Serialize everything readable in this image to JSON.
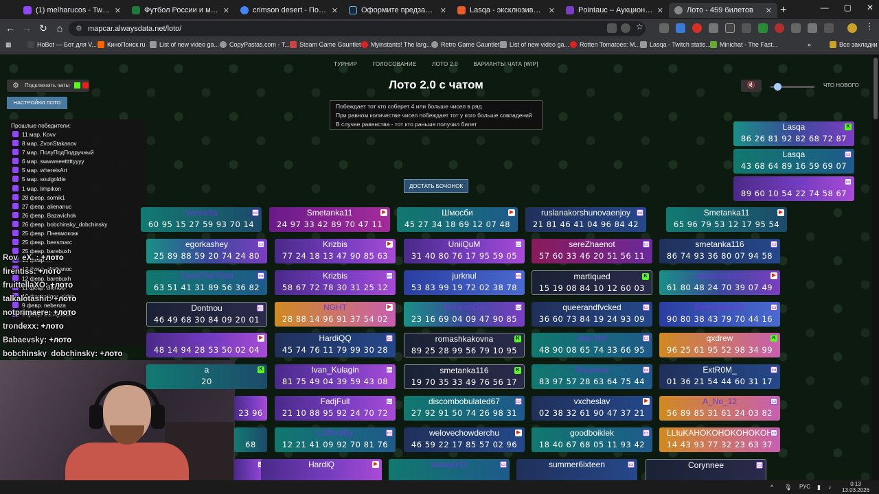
{
  "browser": {
    "tabs": [
      {
        "title": "(1) melharucos - Twitch",
        "color": "#9146ff"
      },
      {
        "title": "Футбол России и мира 2026 -",
        "color": "#1e7a3a"
      },
      {
        "title": "crimson desert - Поиск в Googl",
        "color": "#4285f4"
      },
      {
        "title": "Оформите предзаказ на Crim",
        "color": "#1b2838"
      },
      {
        "title": "Lasqa - эксклюзивный контен",
        "color": "#e85d2a"
      },
      {
        "title": "Pointauc – Аукционы, лотере",
        "color": "#7a3ec2"
      },
      {
        "title": "Лото - 459 билетов",
        "color": "#888888"
      }
    ],
    "new_tab": "+",
    "url": "mapcar.alwaysdata.net/loto/",
    "bookmarks": [
      "НоBot — Бот для V...",
      "КиноПоиск.ru",
      "List of new video ga...",
      "CopyPastas.com - T...",
      "Steam Game Gauntlet",
      "Myinstants! The larg...",
      "Retro Game Gauntlet",
      "List of new video ga...",
      "Rotten Tomatoes: M...",
      "Lasqa - Twitch statis...",
      "Minichat - The Fast..."
    ],
    "bookmarks_all": "Все закладки"
  },
  "page": {
    "nav": [
      "ТУРНИР",
      "ГОЛОСОВАНИЕ",
      "ЛОТО 2.0",
      "ВАРИАНТЫ ЧАТА [WIP]"
    ],
    "title": "Лото 2.0 с чатом",
    "rules": [
      "Побеждает тот кто соберет 4 или больше чисел в ряд",
      "При равном количестве чисел побеждает тот у кого больше совпадений",
      "В случае равенства - тот кто раньше получил билет"
    ],
    "draw_button": "ДОСТАТЬ БОЧОНОК",
    "connect_chats": "Подключить чаты",
    "settings_button": "НАСТРОЙКИ ЛОТО",
    "whats_new": "ЧТО НОВОГО",
    "volume_icon": "speaker-muted-icon",
    "slider_level": 0.1
  },
  "winners": {
    "title": "Прошлые победители:",
    "items": [
      "11 мар. Kovv",
      "8 мар. ZvonStakanov",
      "7 мар. ПолуПодПодручный",
      "6 мар. swwweeetttttyyyy",
      "5 мар. whereisArt",
      "5 мар. soulgoldie",
      "1 мар. limpikon",
      "28 февр. somik1",
      "27 февр. alienanuc",
      "26 февр. Bazavichok",
      "26 февр. bobchinsky_dobchinsky",
      "25 февр. Пневмококк",
      "25 февр. beesmarc",
      "25 февр. barebuxh",
      "15 февр. ...",
      "13 февр. chirbanoc",
      "12 февр. barebuxh",
      "11 февр. Blender",
      "10 февр. tigor_sirkin",
      "9 февр. nebenza",
      "9 февр. DE Aysobil"
    ]
  },
  "chat": [
    {
      "user": "Rov_eX_",
      "text": ": +лото"
    },
    {
      "user": "firentiss",
      "text": ": +лото"
    },
    {
      "user": "fruittellaXO",
      "text": ": +лото"
    },
    {
      "user": "talkalotashit",
      "text": ": +лото"
    },
    {
      "user": "notprimaere",
      "text": ": +лото"
    },
    {
      "user": "trondexx",
      "text": ": +лото"
    },
    {
      "user": "Babaevsky",
      "text": ": +лото"
    },
    {
      "user": "bobchinsky_dobchinsky",
      "text": ": +лото"
    }
  ],
  "tickets": [
    {
      "name": "Lasqa",
      "nums": "86 26 81 92 82 68 72 87",
      "style": "c-tealpurple",
      "badge": "kick",
      "strike": false
    },
    {
      "name": "Lasqa",
      "nums": "43 68 64 89 16 59 69 07",
      "style": "c-tealblue",
      "badge": "twitch",
      "strike": false
    },
    {
      "name": "Lasqa",
      "nums": "89 60 10 54 22 74 58 67",
      "style": "c-purple",
      "badge": "twitch",
      "strike": true
    },
    {
      "name": "Vensetta",
      "nums": "60 95 15 27 59 93 70 14",
      "style": "c-teal",
      "badge": "twitch",
      "strike": true
    },
    {
      "name": "Smetanka11",
      "nums": "24 97 33 42 89 70 47 11",
      "style": "c-magenta",
      "badge": "yt",
      "strike": false
    },
    {
      "name": "Шмосби",
      "nums": "45 27 34 18 69 12 07 48",
      "style": "c-tealblue",
      "badge": "yt",
      "strike": false
    },
    {
      "name": "ruslanakorshunovaenjoy",
      "nums": "21 81 46 41 04 96 84 42",
      "style": "c-navy",
      "badge": "twitch",
      "strike": false
    },
    {
      "name": "Smetanka11",
      "nums": "65 96 79 53 12 17 95 54",
      "style": "c-teal",
      "badge": "yt",
      "strike": false
    },
    {
      "name": "egorkashey",
      "nums": "25 89 88 59 20 74 24 80",
      "style": "c-tealpurple",
      "badge": "twitch",
      "strike": false
    },
    {
      "name": "Krizbis",
      "nums": "77 24 18 13 47 90 85 63",
      "style": "c-purple",
      "badge": "yt",
      "strike": false
    },
    {
      "name": "UniiQuM",
      "nums": "31 40 80 76 17 95 59 05",
      "style": "c-purple",
      "badge": "twitch",
      "strike": false
    },
    {
      "name": "sereZhaenot",
      "nums": "57 60 33 46 20 51 56 11",
      "style": "c-pink",
      "badge": "twitch",
      "strike": false
    },
    {
      "name": "smetanka116",
      "nums": "86 74 93 36 80 07 94 58",
      "style": "c-navy",
      "badge": "twitch",
      "strike": false
    },
    {
      "name": "TyronTheThird",
      "nums": "63 51 41 31 89 56 36 82",
      "style": "c-tealblue",
      "badge": "twitch",
      "strike": true
    },
    {
      "name": "Krizbis",
      "nums": "58 67 72 78 30 31 25 12",
      "style": "c-purple",
      "badge": "twitch",
      "strike": false
    },
    {
      "name": "jurknul",
      "nums": "53 83 99 19 72 02 38 78",
      "style": "c-blue",
      "badge": "twitch",
      "strike": false
    },
    {
      "name": "martiqued",
      "nums": "15 19 08 84 10 12 60 03",
      "style": "c-dark",
      "badge": "kick",
      "strike": false
    },
    {
      "name": "alphacentaur",
      "nums": "61 80 48 24 70 39 07 49",
      "style": "c-tealpurple",
      "badge": "yt",
      "strike": true
    },
    {
      "name": "Dontnou",
      "nums": "46 49 68 30 84 09 20 01",
      "style": "c-dark",
      "badge": "twitch",
      "strike": false
    },
    {
      "name": "NGHT",
      "nums": "28 88 14 96 91 37 54 02",
      "style": "c-gold",
      "badge": "yt",
      "strike": true
    },
    {
      "name": "BecKeitOo",
      "nums": "23 16 69 04 09 47 90 85",
      "style": "c-tealpurple",
      "badge": "twitch",
      "strike": true
    },
    {
      "name": "queerandfvcked",
      "nums": "36 60 73 84 19 24 93 09",
      "style": "c-navy",
      "badge": "twitch",
      "strike": false
    },
    {
      "name": "Beercules515",
      "nums": "90 80 38 43 79 70 44 16",
      "style": "c-blue",
      "badge": "twitch",
      "strike": true
    },
    {
      "name": "Martique",
      "nums": "48 14 94 28 53 50 02 04",
      "style": "c-purple",
      "badge": "yt",
      "strike": true
    },
    {
      "name": "HardiQQ",
      "nums": "45 74 76 11 79 99 30 28",
      "style": "c-navy",
      "badge": "twitch",
      "strike": false
    },
    {
      "name": "romashkakovna",
      "nums": "89 25 28 99 56 79 10 95",
      "style": "c-dark",
      "badge": "kick",
      "strike": false
    },
    {
      "name": "MenTell",
      "nums": "48 90 08 65 74 33 66 95",
      "style": "c-tealblue",
      "badge": "twitch",
      "strike": true
    },
    {
      "name": "qxdrew",
      "nums": "96 25 61 95 52 98 34 99",
      "style": "c-gold",
      "badge": "kick",
      "strike": false
    },
    {
      "name": "a",
      "nums": "20",
      "style": "c-teal",
      "badge": "kick",
      "strike": false
    },
    {
      "name": "Ivan_Kulagin",
      "nums": "81 75 49 04 39 59 43 08",
      "style": "c-purple",
      "badge": "twitch",
      "strike": false
    },
    {
      "name": "smetanka116",
      "nums": "19 70 35 33 49 76 56 17",
      "style": "c-dark",
      "badge": "kick",
      "strike": false
    },
    {
      "name": "Rapoooo",
      "nums": "83 97 57 28 63 64 75 44",
      "style": "c-tealblue",
      "badge": "twitch",
      "strike": true
    },
    {
      "name": "ExtR0M_",
      "nums": "01 36 21 54 44 60 31 17",
      "style": "c-navy",
      "badge": "twitch",
      "strike": false
    },
    {
      "name": "",
      "nums": "23 96",
      "style": "c-purple",
      "badge": "none",
      "strike": false
    },
    {
      "name": "FadjFull",
      "nums": "21 10 88 95 92 24 70 72",
      "style": "c-purple",
      "badge": "twitch",
      "strike": false
    },
    {
      "name": "discombobulated67",
      "nums": "27 92 91 50 74 26 98 31",
      "style": "c-tealblue",
      "badge": "twitch",
      "strike": false
    },
    {
      "name": "vxcheslav",
      "nums": "02 38 32 61 90 47 37 21",
      "style": "c-navy",
      "badge": "yt",
      "strike": false
    },
    {
      "name": "A_No_12",
      "nums": "56 89 85 31 61 24 03 82",
      "style": "c-gold",
      "badge": "twitch",
      "strike": true
    },
    {
      "name": "",
      "nums": "68",
      "style": "c-teal",
      "badge": "none",
      "strike": false
    },
    {
      "name": "CliffordBy",
      "nums": "12 21 41 09 92 70 81 76",
      "style": "c-tealblue",
      "badge": "twitch",
      "strike": true
    },
    {
      "name": "welovechowderchu",
      "nums": "46 59 22 17 85 57 02 96",
      "style": "c-navy",
      "badge": "yt",
      "strike": false
    },
    {
      "name": "goodboiklek",
      "nums": "18 40 67 68 05 11 93 42",
      "style": "c-tealblue",
      "badge": "twitch",
      "strike": false
    },
    {
      "name": "LLIuKAHOKOHOKOHOKOH",
      "nums": "14 43 93 77 32 23 63 37",
      "style": "c-gold",
      "badge": "twitch",
      "strike": false
    },
    {
      "name": "",
      "nums": "",
      "style": "c-purple",
      "badge": "twitch",
      "strike": false
    },
    {
      "name": "HardiQ",
      "nums": "",
      "style": "c-purple",
      "badge": "yt",
      "strike": false
    },
    {
      "name": "bartaa101",
      "nums": "",
      "style": "c-tealblue",
      "badge": "twitch",
      "strike": true
    },
    {
      "name": "summer6ixteen",
      "nums": "",
      "style": "c-navy",
      "badge": "twitch",
      "strike": false
    },
    {
      "name": "Corynnee",
      "nums": "",
      "style": "c-dark",
      "badge": "twitch",
      "strike": false
    }
  ],
  "taskbar": {
    "lang": "РУС",
    "time": "0:13",
    "date": "13.03.2026"
  }
}
